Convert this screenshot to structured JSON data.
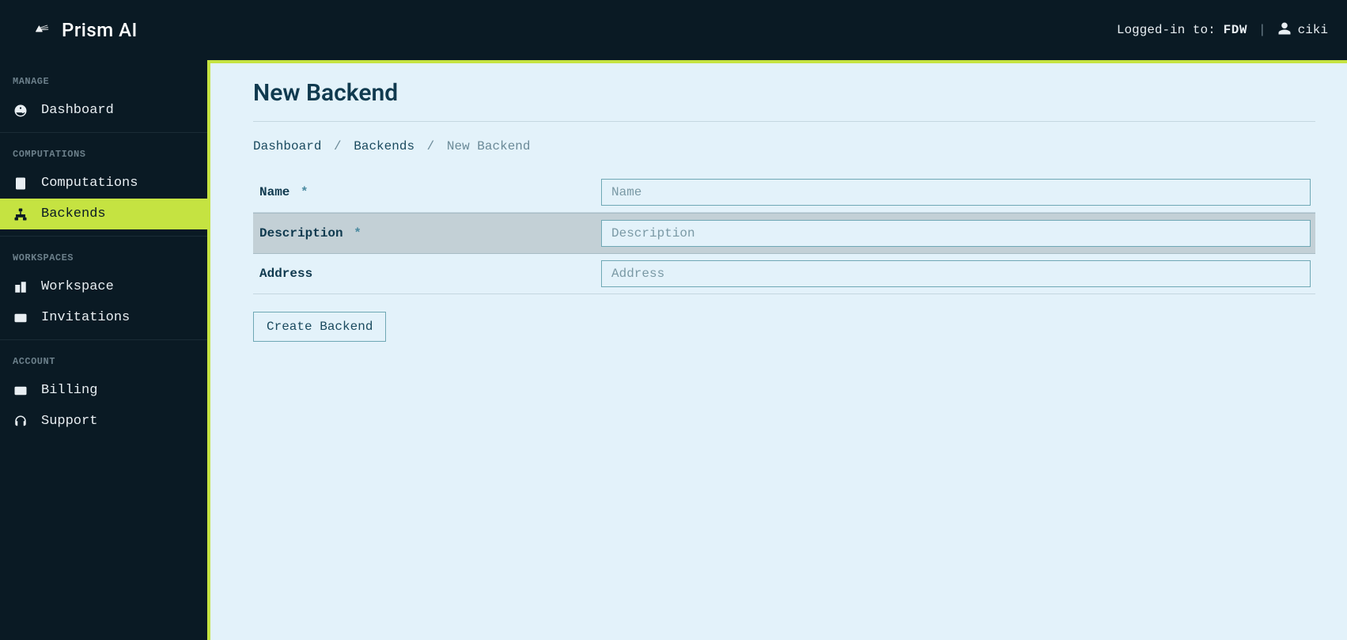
{
  "brand": {
    "name": "Prism AI"
  },
  "header": {
    "logged_in_label": "Logged-in to:",
    "org": "FDW",
    "user": "ciki"
  },
  "sidebar": {
    "sections": [
      {
        "heading": "MANAGE",
        "items": [
          {
            "label": "Dashboard",
            "icon": "gauge-icon",
            "active": false
          }
        ]
      },
      {
        "heading": "COMPUTATIONS",
        "items": [
          {
            "label": "Computations",
            "icon": "calculator-icon",
            "active": false
          },
          {
            "label": "Backends",
            "icon": "sitemap-icon",
            "active": true
          }
        ]
      },
      {
        "heading": "WORKSPACES",
        "items": [
          {
            "label": "Workspace",
            "icon": "buildings-icon",
            "active": false
          },
          {
            "label": "Invitations",
            "icon": "id-card-icon",
            "active": false
          }
        ]
      },
      {
        "heading": "ACCOUNT",
        "items": [
          {
            "label": "Billing",
            "icon": "credit-card-icon",
            "active": false
          },
          {
            "label": "Support",
            "icon": "headset-icon",
            "active": false
          }
        ]
      }
    ]
  },
  "page": {
    "title": "New Backend",
    "breadcrumbs": {
      "items": [
        "Dashboard",
        "Backends"
      ],
      "current": "New Backend"
    },
    "form": {
      "fields": [
        {
          "label": "Name",
          "required": true,
          "placeholder": "Name",
          "highlight": false
        },
        {
          "label": "Description",
          "required": true,
          "placeholder": "Description",
          "highlight": true
        },
        {
          "label": "Address",
          "required": false,
          "placeholder": "Address",
          "highlight": false
        }
      ],
      "submit_label": "Create Backend"
    }
  }
}
